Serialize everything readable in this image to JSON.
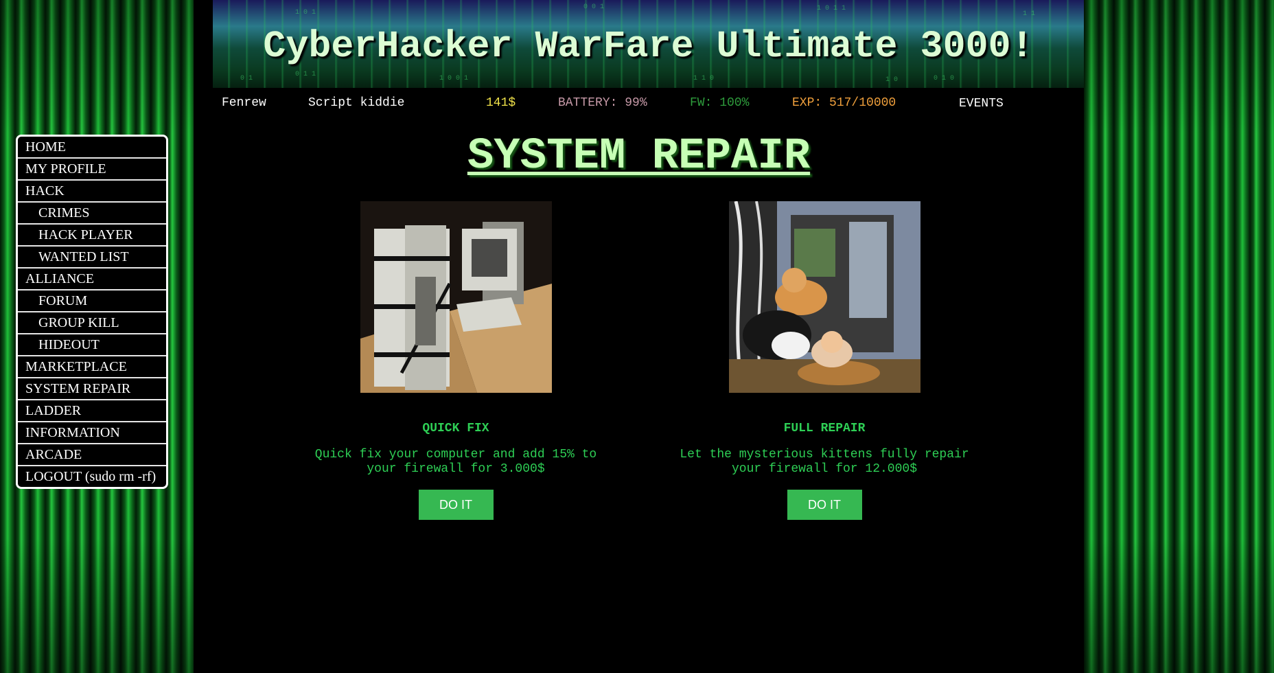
{
  "banner": {
    "title": "CyberHacker WarFare Ultimate 3000!"
  },
  "status": {
    "username": "Fenrew",
    "rank": "Script kiddie",
    "money": "141$",
    "battery": "BATTERY: 99%",
    "firewall": "FW: 100%",
    "experience": "EXP: 517/10000",
    "events": "EVENTS"
  },
  "colors": {
    "money": "#f0e24a",
    "battery": "#c79aa8",
    "firewall": "#2e9c3c",
    "experience": "#f0a03c",
    "accent_green": "#2ecf55",
    "button_green": "#36b852"
  },
  "nav": {
    "items": [
      {
        "label": "HOME",
        "sub": false
      },
      {
        "label": "MY PROFILE",
        "sub": false
      },
      {
        "label": "HACK",
        "sub": false
      },
      {
        "label": "CRIMES",
        "sub": true
      },
      {
        "label": "HACK PLAYER",
        "sub": true
      },
      {
        "label": "WANTED LIST",
        "sub": true
      },
      {
        "label": "ALLIANCE",
        "sub": false
      },
      {
        "label": "FORUM",
        "sub": true
      },
      {
        "label": "GROUP KILL",
        "sub": true
      },
      {
        "label": "HIDEOUT",
        "sub": true
      },
      {
        "label": "MARKETPLACE",
        "sub": false
      },
      {
        "label": "SYSTEM REPAIR",
        "sub": false
      },
      {
        "label": "LADDER",
        "sub": false
      },
      {
        "label": "INFORMATION",
        "sub": false
      },
      {
        "label": "ARCADE",
        "sub": false
      },
      {
        "label": "LOGOUT (sudo rm -rf)",
        "sub": false
      }
    ]
  },
  "page": {
    "title": "SYSTEM REPAIR"
  },
  "options": [
    {
      "title": "QUICK FIX",
      "description": "Quick fix your computer and add 15% to your firewall for 3.000$",
      "button": "DO IT",
      "image": "taped-up-computer-photo"
    },
    {
      "title": "FULL REPAIR",
      "description": "Let the mysterious kittens fully repair your firewall for 12.000$",
      "button": "DO IT",
      "image": "kittens-in-computer-case-photo"
    }
  ]
}
